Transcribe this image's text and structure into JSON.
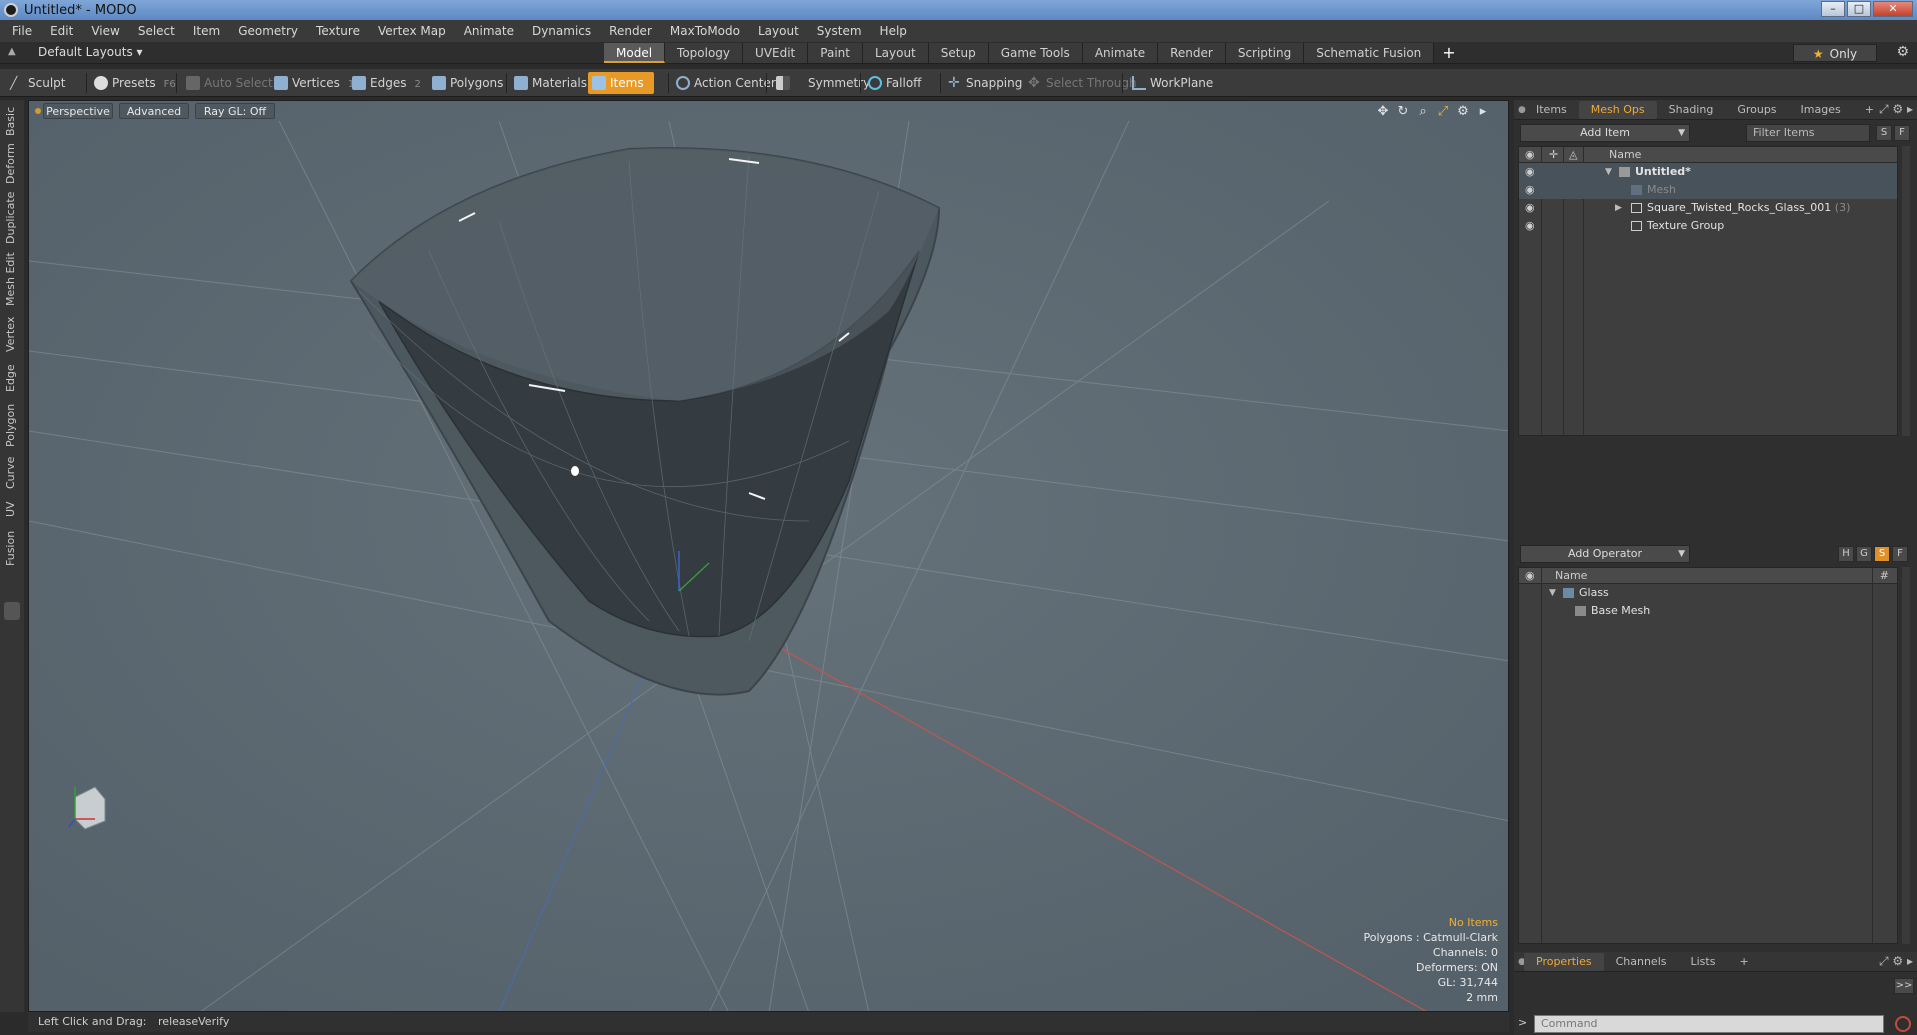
{
  "window": {
    "title": "Untitled* - MODO",
    "minimize": "–",
    "maximize": "□",
    "close": "✕"
  },
  "menu": [
    "File",
    "Edit",
    "View",
    "Select",
    "Item",
    "Geometry",
    "Texture",
    "Vertex Map",
    "Animate",
    "Dynamics",
    "Render",
    "MaxToModo",
    "Layout",
    "System",
    "Help"
  ],
  "layout": {
    "selector": "Default Layouts ▾",
    "tabs": [
      "Model",
      "Topology",
      "UVEdit",
      "Paint",
      "Layout",
      "Setup",
      "Game Tools",
      "Animate",
      "Render",
      "Scripting",
      "Schematic Fusion"
    ],
    "active_tab": "Model",
    "add_tab": "+",
    "only_label": "Only"
  },
  "toolbar": {
    "sculpt": "Sculpt",
    "presets": "Presets",
    "presets_key": "F6",
    "auto_select": "Auto Select",
    "vertices": "Vertices",
    "vertices_key": "1",
    "edges": "Edges",
    "edges_key": "2",
    "polygons": "Polygons",
    "materials": "Materials",
    "items": "Items",
    "action_center": "Action Center",
    "symmetry": "Symmetry",
    "falloff": "Falloff",
    "snapping": "Snapping",
    "select_through": "Select Through",
    "workplane": "WorkPlane"
  },
  "left_tabs": [
    "Basic",
    "Deform",
    "Duplicate",
    "Mesh Edit",
    "Vertex",
    "Edge",
    "Polygon",
    "Curve",
    "UV",
    "Fusion"
  ],
  "viewport": {
    "view": "Perspective",
    "shading": "Advanced",
    "raygl": "Ray GL: Off",
    "info": {
      "no_items": "No Items",
      "polygons": "Polygons : Catmull-Clark",
      "channels": "Channels: 0",
      "deformers": "Deformers: ON",
      "gl": "GL: 31,744",
      "grid": "2 mm"
    }
  },
  "status": {
    "label": "Left Click and Drag:",
    "value": "releaseVerify"
  },
  "items_panel": {
    "tabs": [
      "Items",
      "Mesh Ops",
      "Shading",
      "Groups",
      "Images",
      "+"
    ],
    "active_tab": "Mesh Ops",
    "add_item": "Add Item",
    "filter": "Filter Items",
    "btn_s": "S",
    "btn_f": "F",
    "col_name": "Name",
    "rows": [
      {
        "label": "Untitled*"
      },
      {
        "label": "Mesh"
      },
      {
        "label": "Square_Twisted_Rocks_Glass_001",
        "count": "(3)"
      },
      {
        "label": "Texture Group"
      }
    ]
  },
  "operator_panel": {
    "add_operator": "Add Operator",
    "btn_h": "H",
    "btn_g": "G",
    "btn_s": "S",
    "btn_f": "F",
    "col_name": "Name",
    "col_hash": "#",
    "rows": [
      {
        "label": "Glass"
      },
      {
        "label": "Base Mesh"
      }
    ]
  },
  "props_panel": {
    "tabs": [
      "Properties",
      "Channels",
      "Lists",
      "+"
    ],
    "active_tab": "Properties",
    "expand": ">>"
  },
  "command": {
    "prompt": ">",
    "placeholder": "Command"
  },
  "colors": {
    "accent": "#e99a26",
    "viewport_bg": "#5b666d",
    "panel_bg": "#2f2f2f"
  }
}
